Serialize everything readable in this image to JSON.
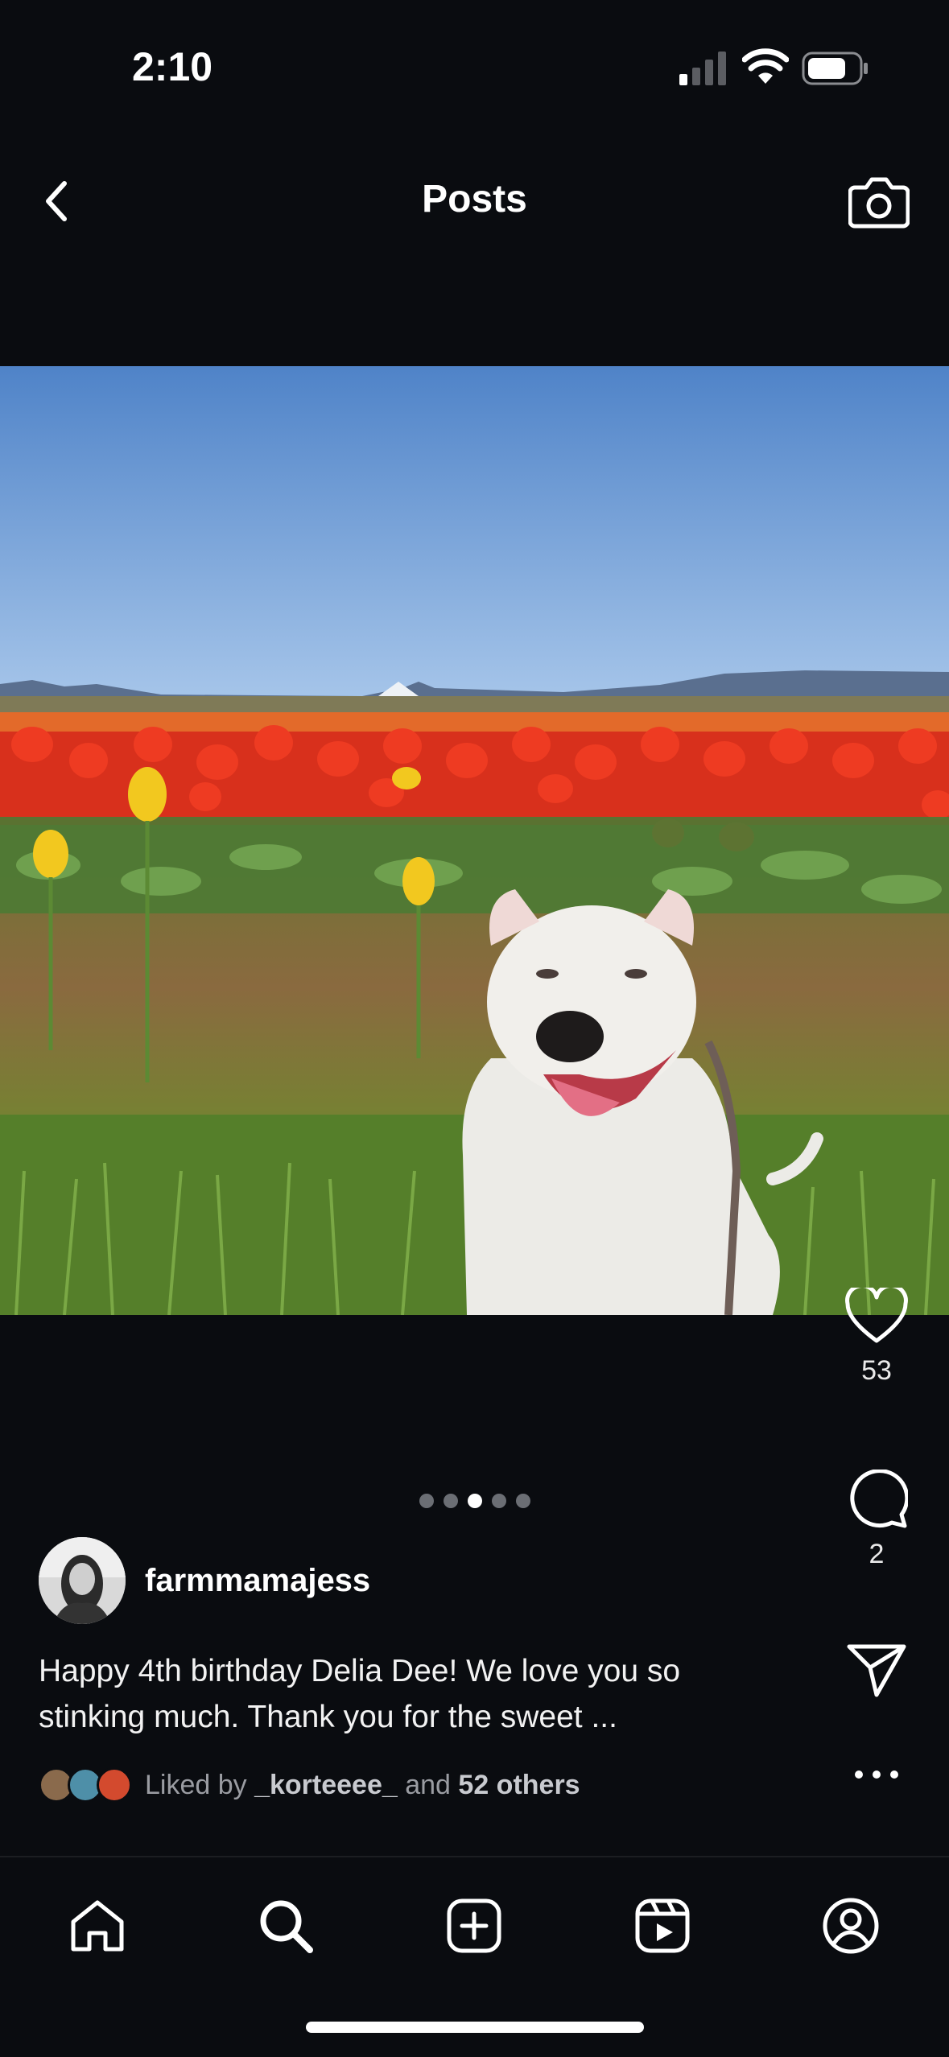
{
  "status_bar": {
    "time": "2:10",
    "icons": [
      "cellular-signal-icon",
      "wifi-icon",
      "battery-icon"
    ]
  },
  "header": {
    "title": "Posts",
    "back_icon": "chevron-left-icon",
    "camera_icon": "camera-icon"
  },
  "post": {
    "image_description_icon": "photo",
    "carousel": {
      "count": 5,
      "active_index": 2
    },
    "author": {
      "username": "farmmamajess"
    },
    "caption": "Happy 4th birthday Delia Dee! We love you so stinking much. Thank you for the sweet ...",
    "liked_by": {
      "prefix": "Liked by",
      "first_user": "_korteeee_",
      "connector": "and",
      "others": "52 others"
    },
    "actions": {
      "likes": "53",
      "comments": "2"
    }
  },
  "bottom_nav": {
    "items": [
      "home-icon",
      "search-icon",
      "create-post-icon",
      "reels-icon",
      "profile-icon"
    ]
  },
  "colors": {
    "background": "#0a0c10",
    "text": "#ffffff",
    "muted_text": "#9a9ca2"
  }
}
